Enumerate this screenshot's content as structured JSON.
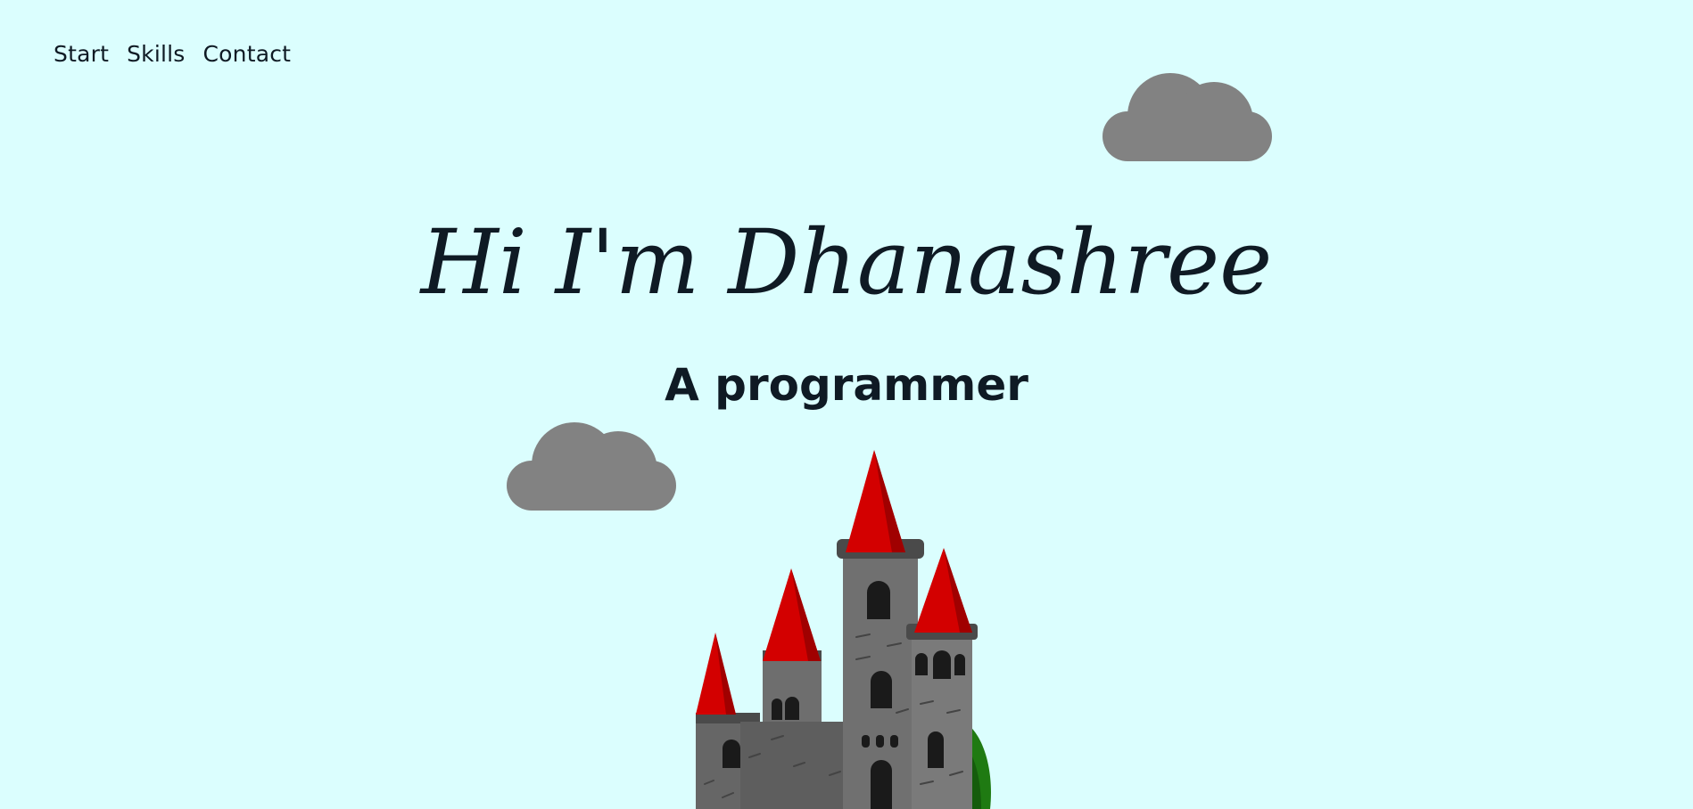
{
  "nav": {
    "items": [
      {
        "label": "Start"
      },
      {
        "label": "Skills"
      },
      {
        "label": "Contact"
      }
    ]
  },
  "hero": {
    "title": "Hi I'm Dhanashree",
    "subtitle": "A programmer"
  },
  "colors": {
    "background": "#dbfefe",
    "text": "#0f1a24",
    "cloud": "#828282",
    "castle_stone": "#6e6e6e",
    "castle_roof": "#d30000",
    "foliage": "#1f7a12"
  },
  "icons": {
    "cloud": "cloud-icon",
    "castle": "castle-illustration"
  }
}
